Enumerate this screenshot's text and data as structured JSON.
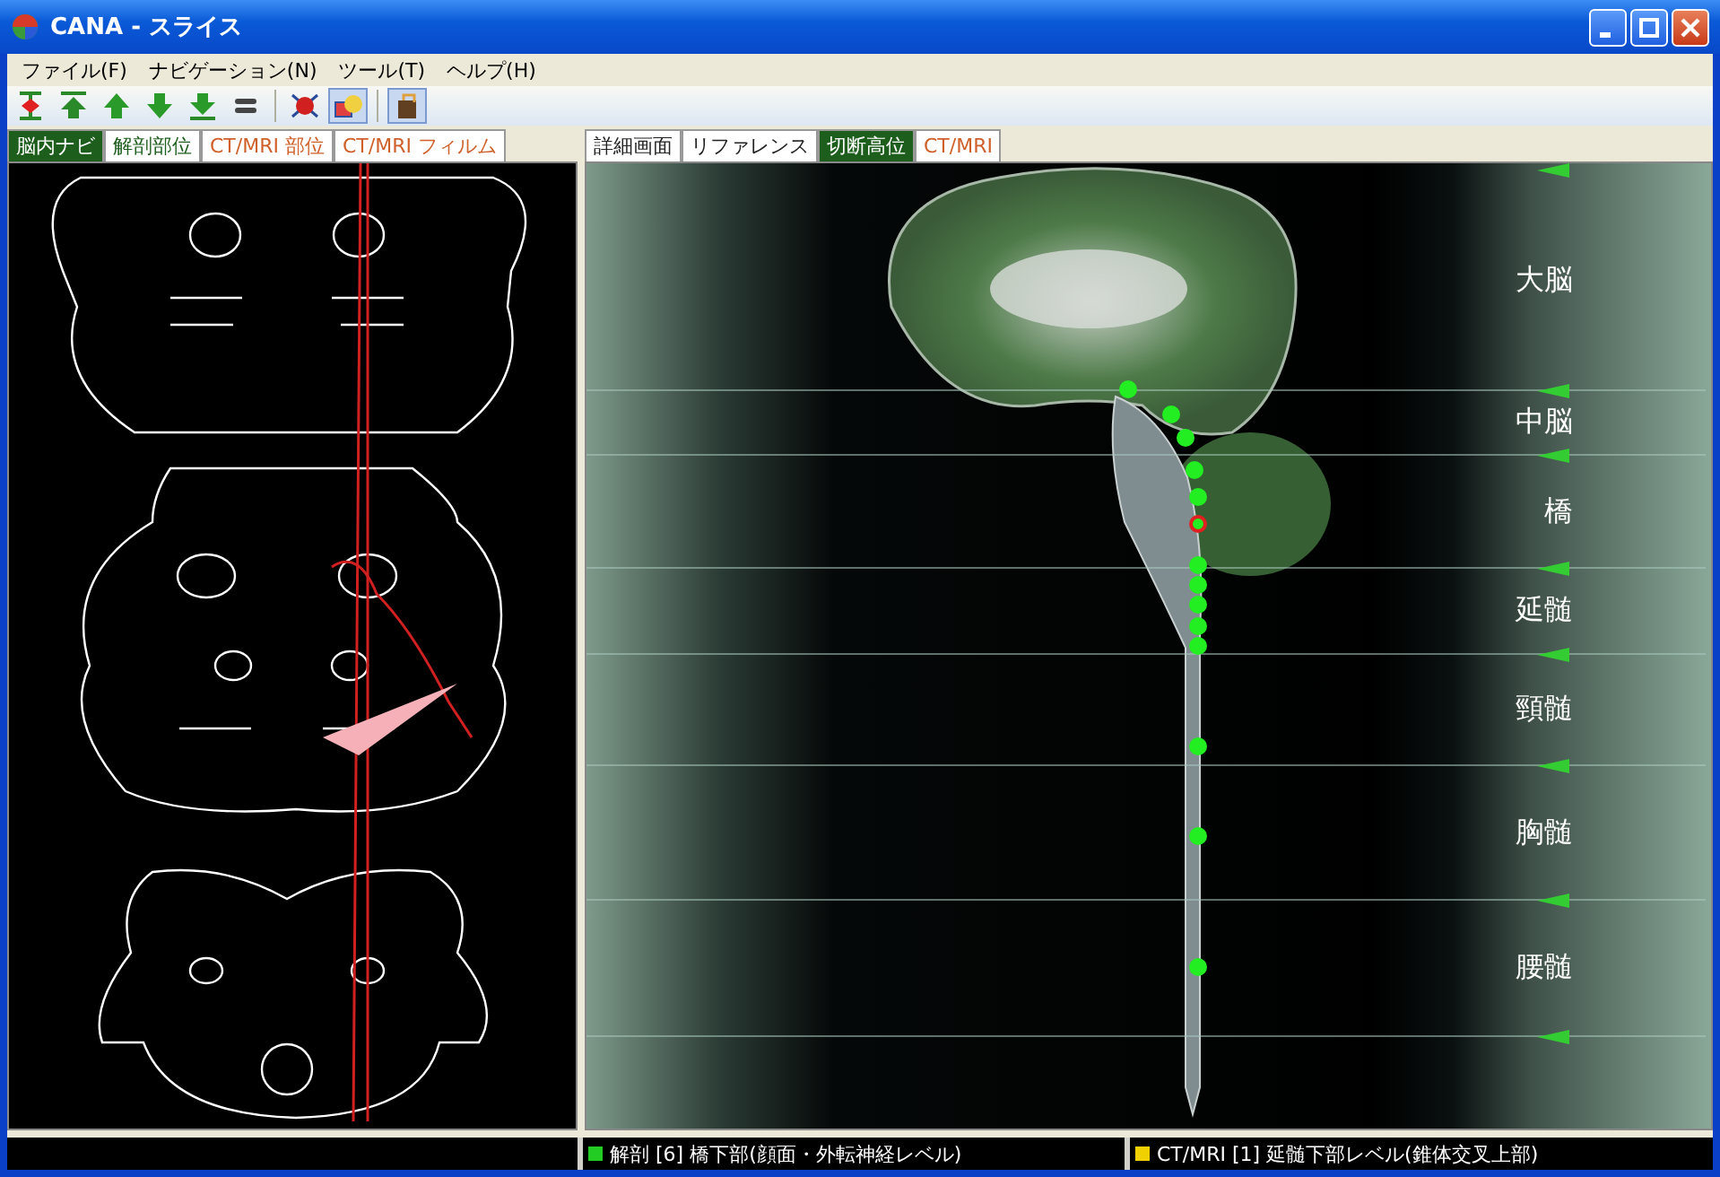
{
  "window": {
    "title": "CANA - スライス"
  },
  "menu": [
    "ファイル(F)",
    "ナビゲーション(N)",
    "ツール(T)",
    "ヘルプ(H)"
  ],
  "toolbar": [
    {
      "kind": "center",
      "pressed": false
    },
    {
      "kind": "top",
      "pressed": false
    },
    {
      "kind": "up",
      "pressed": false
    },
    {
      "kind": "down",
      "pressed": false
    },
    {
      "kind": "bottom",
      "pressed": false
    },
    {
      "kind": "equal",
      "pressed": false
    },
    {
      "kind": "cross",
      "pressed": false
    },
    {
      "kind": "overlay",
      "pressed": true
    },
    {
      "kind": "film",
      "pressed": true
    }
  ],
  "left_tabs": [
    {
      "label": "脳内ナビ",
      "selected": true,
      "color": "#1d5e1d"
    },
    {
      "label": "解剖部位",
      "selected": false,
      "color": "#1d5e1d"
    },
    {
      "label": "CT/MRI 部位",
      "selected": false,
      "color": "#d0602a"
    },
    {
      "label": "CT/MRI フィルム",
      "selected": false,
      "color": "#d0602a"
    }
  ],
  "right_tabs": [
    {
      "label": "詳細画面",
      "selected": false,
      "color": "#222222"
    },
    {
      "label": "リファレンス",
      "selected": false,
      "color": "#222222"
    },
    {
      "label": "切断高位",
      "selected": true,
      "color": "#1d5e1d"
    },
    {
      "label": "CT/MRI",
      "selected": false,
      "color": "#d0602a"
    }
  ],
  "levels": [
    "大脳",
    "中脳",
    "橋",
    "延髄",
    "頸髄",
    "胸髄",
    "腰髄"
  ],
  "slice_markers": [
    {
      "selected": false
    },
    {
      "selected": false
    },
    {
      "selected": false
    },
    {
      "selected": false
    },
    {
      "selected": false
    },
    {
      "selected": true
    },
    {
      "selected": false
    },
    {
      "selected": false
    },
    {
      "selected": false
    },
    {
      "selected": false
    },
    {
      "selected": false
    },
    {
      "selected": false
    },
    {
      "selected": false
    },
    {
      "selected": false
    }
  ],
  "status_bar": [
    {
      "text": "解剖 [6] 橋下部(顔面・外転神経レベル)",
      "color": "#22cc22"
    },
    {
      "text": "CT/MRI [1] 延髄下部レベル(錐体交叉上部)",
      "color": "#f0d000"
    }
  ]
}
